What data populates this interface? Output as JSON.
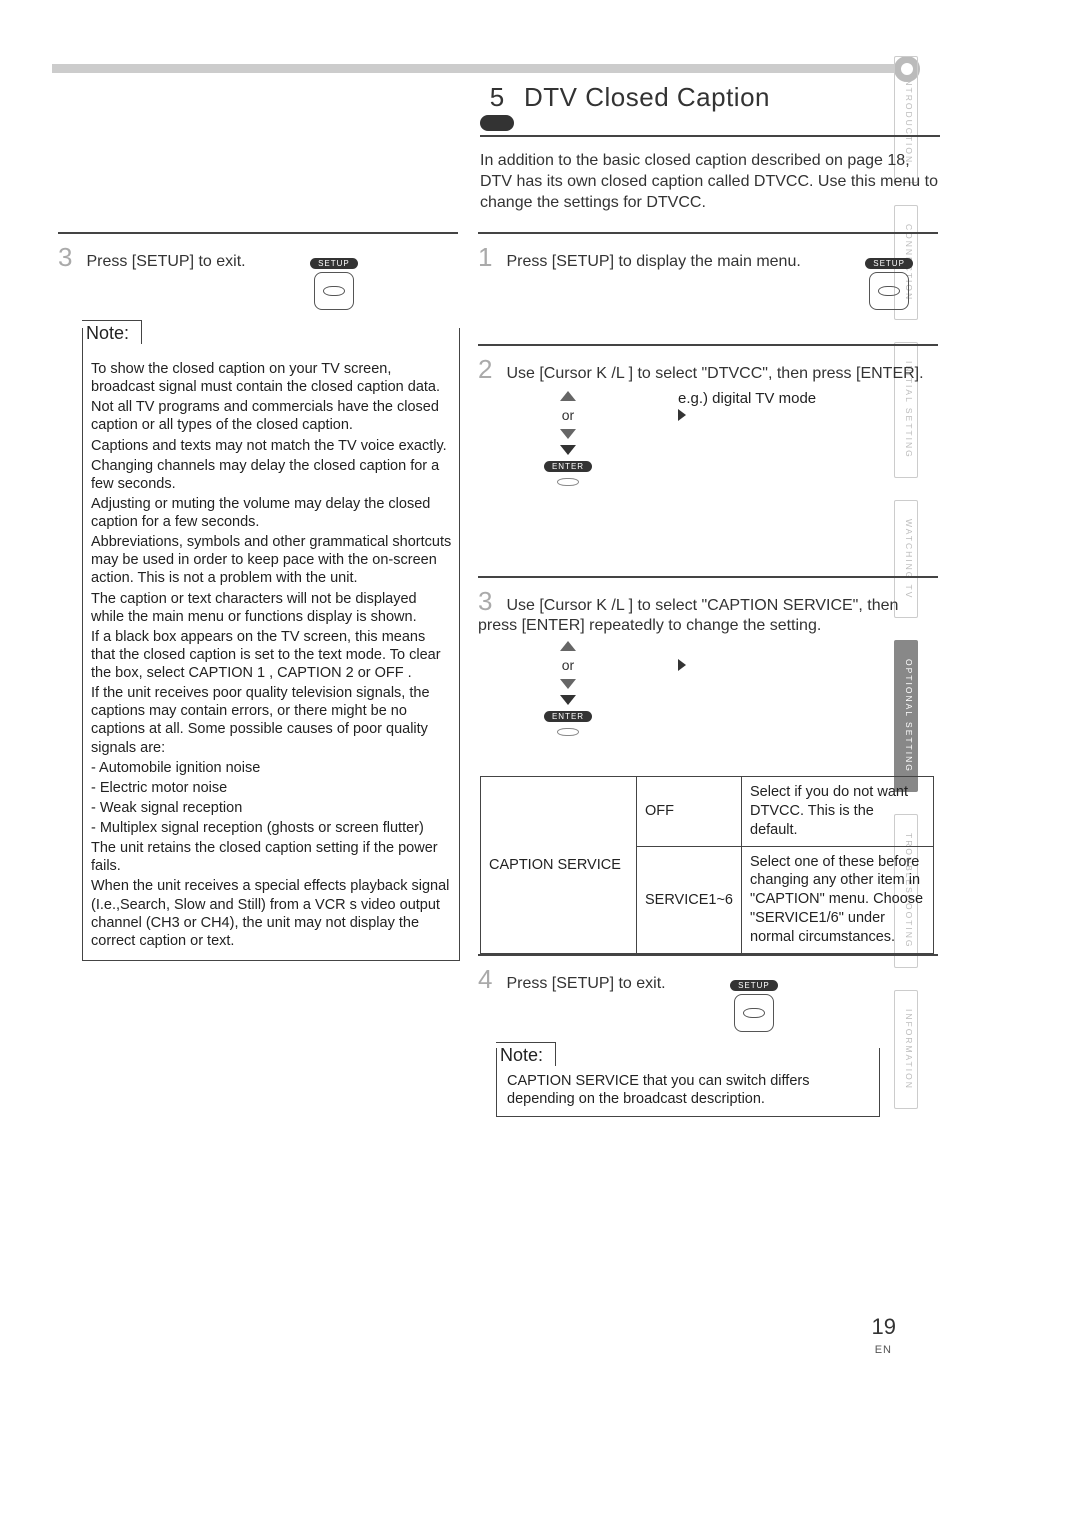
{
  "side_tabs": {
    "t0": "INTRODUCTION",
    "t1": "CONNECTION",
    "t2": "INITIAL  SETTING",
    "t3": "WATCHING  TV",
    "t4": "OPTIONAL  SETTING",
    "t5": "TROUBLESHOOTING",
    "t6": "INFORMATION"
  },
  "heading": {
    "num": "5",
    "title": "DTV Closed Caption",
    "intro": "In addition to the basic closed caption described on page 18, DTV has its own closed caption called DTVCC. Use this menu to change the settings for DTVCC."
  },
  "left": {
    "step3": "Press [SETUP] to exit.",
    "remote_label": "SETUP",
    "note_title": "Note:",
    "notes": {
      "n0": "To show the closed caption on your TV screen, broadcast signal must contain the closed caption data.",
      "n1": "Not all TV programs and commercials have the closed caption or all types of the closed caption.",
      "n2": "Captions and texts may not match the TV voice exactly.",
      "n3": "Changing channels may delay the closed caption for a few seconds.",
      "n4": "Adjusting or muting the volume may delay the closed caption for a few seconds.",
      "n5": "Abbreviations, symbols and other grammatical shortcuts may be used in order to keep pace with the on-screen action. This is not a problem with the unit.",
      "n6": "The caption or text characters will not be displayed while the main menu or functions display is shown.",
      "n7": "If a black box appears on the TV screen, this means that the closed caption is set to the text mode. To clear the box, select  CAPTION 1 ,  CAPTION 2  or  OFF .",
      "n8": "If the unit receives poor quality television signals, the captions may contain errors, or there might be no captions at all. Some possible causes of poor quality signals are:",
      "n8a": "- Automobile ignition noise",
      "n8b": "- Electric motor noise",
      "n8c": "- Weak signal reception",
      "n8d": "- Multiplex signal reception (ghosts or screen flutter)",
      "n9": "The unit retains the closed caption setting if the power fails.",
      "n10": "When the unit receives a special effects playback signal (I.e.,Search, Slow and Still) from a VCR s video output channel (CH3 or CH4), the unit may not display the correct caption or text."
    }
  },
  "right": {
    "step1": "Press [SETUP] to display the main menu.",
    "remote_label": "SETUP",
    "step2": "Use [Cursor K /L ] to select \"DTVCC\", then press [ENTER].",
    "eg": "e.g.) digital TV mode",
    "or": "or",
    "enter": "ENTER",
    "step3": "Use [Cursor K /L ] to select \"CAPTION SERVICE\", then press [ENTER] repeatedly to change the setting.",
    "svc_label": "CAPTION SERVICE",
    "svc_off": "OFF",
    "svc_off_desc": "Select if you do not want DTVCC. This is the default.",
    "svc_range": "SERVICE1~6",
    "svc_range_desc": "Select one of these before changing any other item in \"CAPTION\" menu. Choose \"SERVICE1/6\" under normal circumstances.",
    "step4": "Press [SETUP] to exit.",
    "note_title": "Note:",
    "note2": "CAPTION SERVICE  that you can switch differs depending on the broadcast description."
  },
  "step_nums": {
    "s1": "1",
    "s2": "2",
    "s3": "3",
    "s4": "4",
    "s3l": "3"
  },
  "footer": {
    "page": "19",
    "lang": "EN"
  }
}
